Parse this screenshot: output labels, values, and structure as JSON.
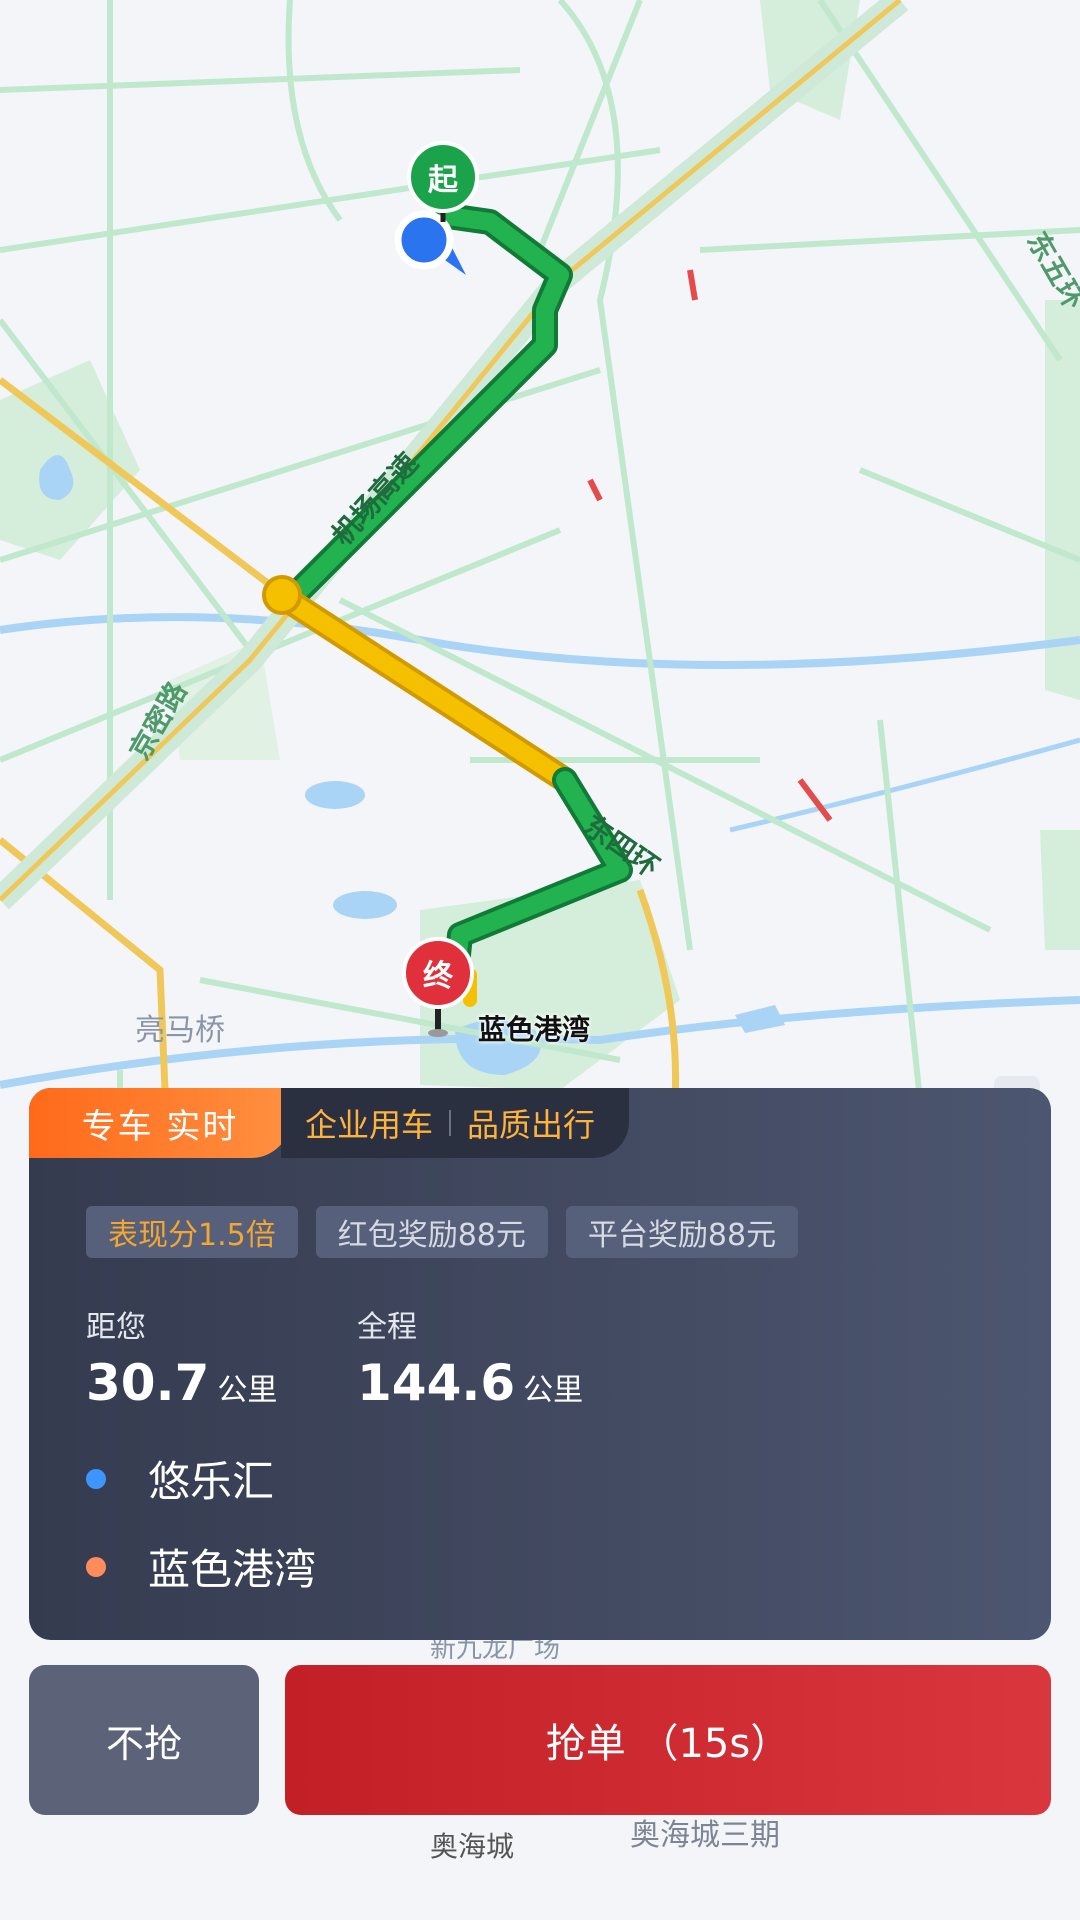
{
  "map": {
    "labels": {
      "road_airport": "机场高速",
      "road_jingmi": "京密路",
      "road_east4": "东四环",
      "road_east5": "东五环",
      "area_liangmaqiao": "亮马桥",
      "area_aohaicheng": "奥海城",
      "area_aohaicheng3": "奥海城三期",
      "area_xinjiulong": "新九龙广场"
    },
    "start_pin": "起",
    "end_pin": "终",
    "destination_label": "蓝色港湾",
    "colors": {
      "route_clear": "#1aa34a",
      "route_slow": "#f2b500",
      "water": "#a9d4f5",
      "park": "#cdebd3",
      "road": "#b9e6c9"
    }
  },
  "card": {
    "tag_main": "专车 实时",
    "tag_sub_1": "企业用车",
    "tag_sub_2": "品质出行",
    "chips": [
      "表现分1.5倍",
      "红包奖励88元",
      "平台奖励88元"
    ],
    "distance_to_you": {
      "label": "距您",
      "value": "30.7",
      "unit": "公里"
    },
    "total_distance": {
      "label": "全程",
      "value": "144.6",
      "unit": "公里"
    },
    "pickup": "悠乐汇",
    "dropoff": "蓝色港湾",
    "colors": {
      "pickup_dot": "#3d96ff",
      "dropoff_dot": "#ff8c5a"
    }
  },
  "actions": {
    "skip_label": "不抢",
    "grab_label": "抢单 （15s）"
  }
}
